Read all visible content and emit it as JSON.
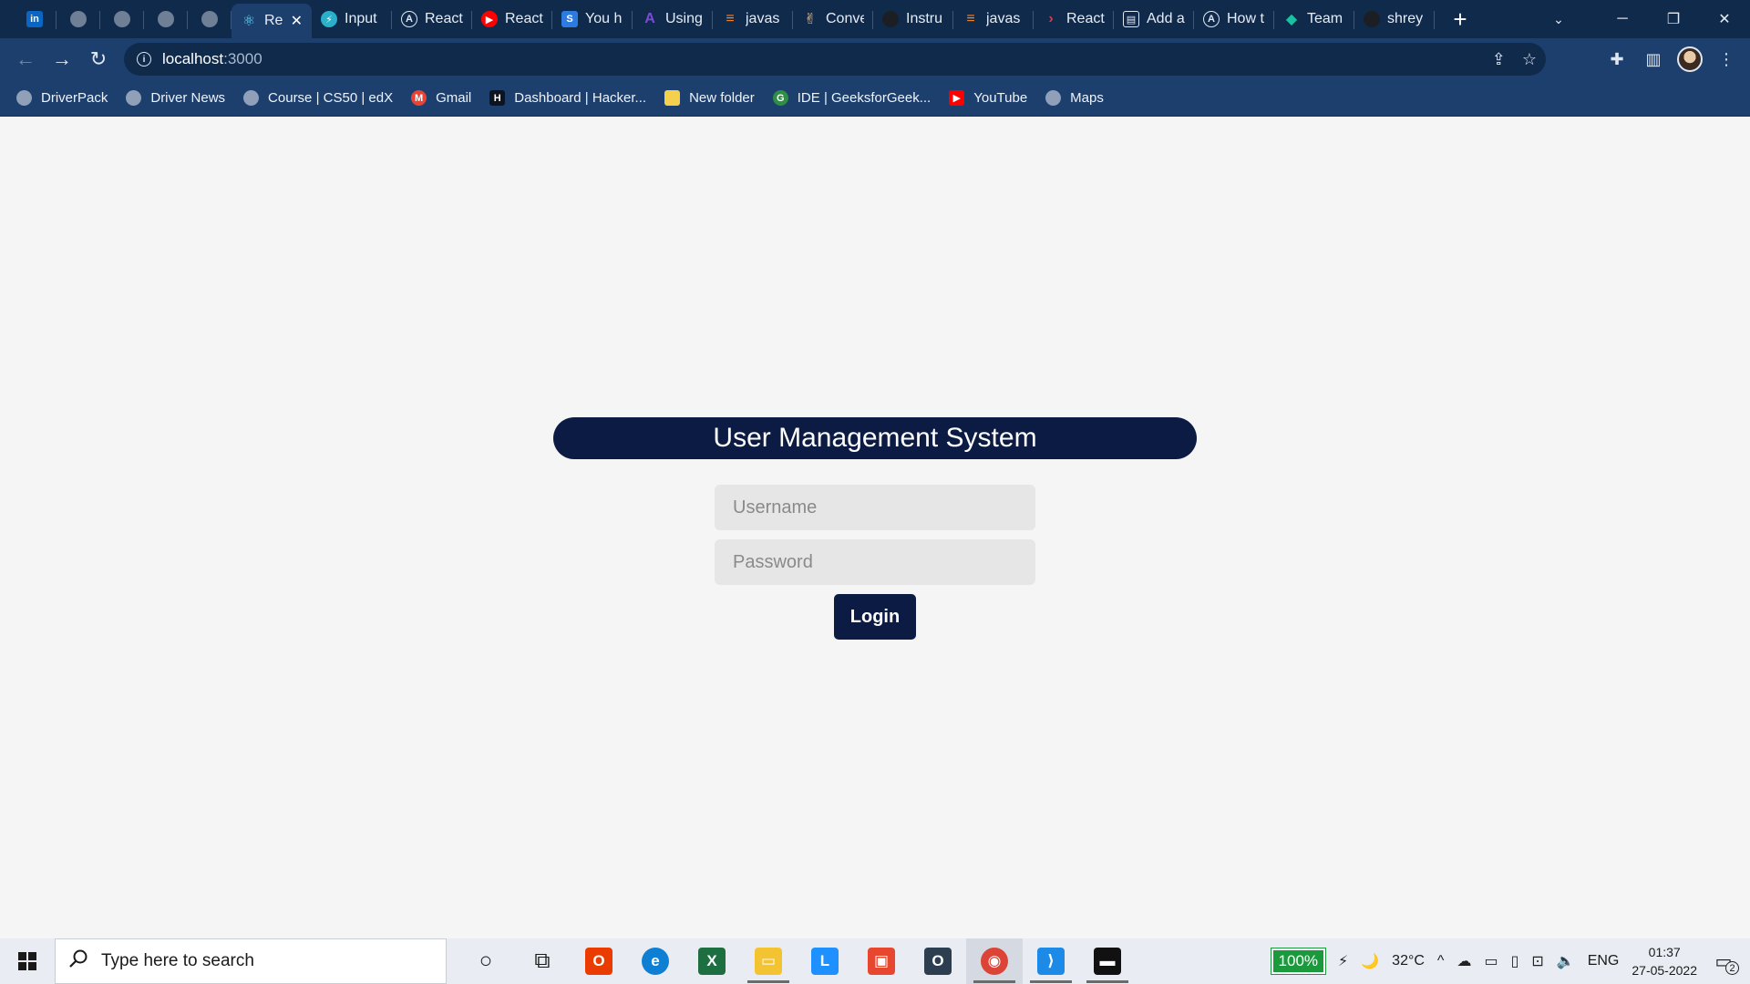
{
  "browser": {
    "tabs": [
      {
        "label": "",
        "icon": "linkedin-icon",
        "color": "#0a66c2",
        "glyph": "in",
        "kind": "pinned"
      },
      {
        "label": "",
        "icon": "globe-icon",
        "color": "#6f7f95",
        "glyph": "",
        "kind": "pinned"
      },
      {
        "label": "",
        "icon": "globe-icon",
        "color": "#6f7f95",
        "glyph": "",
        "kind": "pinned"
      },
      {
        "label": "",
        "icon": "globe-icon",
        "color": "#6f7f95",
        "glyph": "",
        "kind": "pinned"
      },
      {
        "label": "",
        "icon": "globe-icon",
        "color": "#6f7f95",
        "glyph": "",
        "kind": "pinned"
      },
      {
        "label": "Re",
        "icon": "react-icon",
        "color": "#61dafb",
        "glyph": "⚛",
        "kind": "active"
      },
      {
        "label": "Input",
        "icon": "bolt-icon",
        "color": "#2bb0c9",
        "glyph": "⚡",
        "kind": "normal"
      },
      {
        "label": "React",
        "icon": "angular-a-icon",
        "color": "#dfe7f2",
        "glyph": "A",
        "kind": "normal"
      },
      {
        "label": "React",
        "icon": "youtube-icon",
        "color": "#ff0000",
        "glyph": "▶",
        "kind": "normal"
      },
      {
        "label": "You h",
        "icon": "s-logo-icon",
        "color": "#2d7ae0",
        "glyph": "S",
        "kind": "normal"
      },
      {
        "label": "Using",
        "icon": "rocket-icon",
        "color": "#7b4bd8",
        "glyph": "A",
        "kind": "normal"
      },
      {
        "label": "javas",
        "icon": "stackoverflow-icon",
        "color": "#f48024",
        "glyph": "≡",
        "kind": "normal"
      },
      {
        "label": "Conve",
        "icon": "peace-hand-icon",
        "color": "#f0c69a",
        "glyph": "✌",
        "kind": "normal"
      },
      {
        "label": "Instru",
        "icon": "github-icon",
        "color": "#1b1f24",
        "glyph": "",
        "kind": "normal"
      },
      {
        "label": "javas",
        "icon": "stackoverflow-icon",
        "color": "#f48024",
        "glyph": "≡",
        "kind": "normal"
      },
      {
        "label": "React",
        "icon": "chevron-red-icon",
        "color": "#e0364a",
        "glyph": "›",
        "kind": "normal"
      },
      {
        "label": "Add a",
        "icon": "doc-icon",
        "color": "#dfe7f2",
        "glyph": "▤",
        "kind": "normal"
      },
      {
        "label": "How t",
        "icon": "angular-a-icon",
        "color": "#dfe7f2",
        "glyph": "A",
        "kind": "normal"
      },
      {
        "label": "Team",
        "icon": "diamond-icon",
        "color": "#17c3a0",
        "glyph": "◆",
        "kind": "normal"
      },
      {
        "label": "shrey",
        "icon": "github-icon",
        "color": "#1b1f24",
        "glyph": "",
        "kind": "normal"
      }
    ],
    "new_tab": "+",
    "window_controls": {
      "minimize": "─",
      "restore": "❐",
      "close": "✕"
    },
    "tab_search": "⌄",
    "nav": {
      "back": "←",
      "forward": "→",
      "reload": "↻"
    },
    "omnibox": {
      "info_glyph": "i",
      "host": "localhost",
      "port": ":3000"
    },
    "toolbar_icons": {
      "share": "⇪",
      "star": "☆",
      "extensions": "✚",
      "sidepanel": "▥",
      "menu": "⋮"
    },
    "bookmarks": [
      {
        "label": "DriverPack",
        "icon": "globe-icon",
        "color": "#8fa0b8",
        "glyph": ""
      },
      {
        "label": "Driver News",
        "icon": "globe-icon",
        "color": "#8fa0b8",
        "glyph": ""
      },
      {
        "label": "Course | CS50 | edX",
        "icon": "globe-icon",
        "color": "#8fa0b8",
        "glyph": ""
      },
      {
        "label": "Gmail",
        "icon": "gmail-icon",
        "color": "#ea4335",
        "glyph": "M"
      },
      {
        "label": "Dashboard | Hacker...",
        "icon": "hackerrank-icon",
        "color": "#0e141e",
        "glyph": "H"
      },
      {
        "label": "New folder",
        "icon": "folder-icon",
        "color": "#f4d04d",
        "glyph": ""
      },
      {
        "label": "IDE | GeeksforGeek...",
        "icon": "geeksforgeeks-icon",
        "color": "#2f8d46",
        "glyph": "G"
      },
      {
        "label": "YouTube",
        "icon": "youtube-icon",
        "color": "#ff0000",
        "glyph": "▶"
      },
      {
        "label": "Maps",
        "icon": "globe-icon",
        "color": "#8fa0b8",
        "glyph": ""
      }
    ]
  },
  "page": {
    "title": "User Management System",
    "username_placeholder": "Username",
    "password_placeholder": "Password",
    "login_label": "Login"
  },
  "taskbar": {
    "search_placeholder": "Type here to search",
    "apps": [
      {
        "name": "cortana-icon",
        "color": "#1a1a1a",
        "glyph": "○",
        "state": ""
      },
      {
        "name": "task-view-icon",
        "color": "#1a1a1a",
        "glyph": "⧉",
        "state": ""
      },
      {
        "name": "office-icon",
        "color": "#eb3c00",
        "glyph": "O",
        "state": ""
      },
      {
        "name": "edge-icon",
        "color": "#0f7fd3",
        "glyph": "e",
        "state": ""
      },
      {
        "name": "excel-icon",
        "color": "#1d6f42",
        "glyph": "X",
        "state": ""
      },
      {
        "name": "file-explorer-icon",
        "color": "#f4c331",
        "glyph": "▭",
        "state": "running"
      },
      {
        "name": "l-app-icon",
        "color": "#1e90ff",
        "glyph": "L",
        "state": ""
      },
      {
        "name": "red-app-icon",
        "color": "#e8472f",
        "glyph": "▣",
        "state": ""
      },
      {
        "name": "o-app-icon",
        "color": "#2c3e50",
        "glyph": "O",
        "state": ""
      },
      {
        "name": "chrome-icon",
        "color": "#db4437",
        "glyph": "◉",
        "state": "running active"
      },
      {
        "name": "vscode-icon",
        "color": "#1c8ae6",
        "glyph": "⟩",
        "state": "running"
      },
      {
        "name": "terminal-icon",
        "color": "#111111",
        "glyph": "▬",
        "state": "running"
      }
    ],
    "battery_label": "100%",
    "plug_glyph": "⚡",
    "weather_glyph": "🌙",
    "temperature": "32°C",
    "tray_icons": {
      "chevron": "^",
      "cloud": "☁",
      "network": "▭",
      "device": "▯",
      "wifi": "⊡",
      "volume": "🔈"
    },
    "language": "ENG",
    "time": "01:37",
    "date": "27-05-2022",
    "notification_count": "2"
  }
}
